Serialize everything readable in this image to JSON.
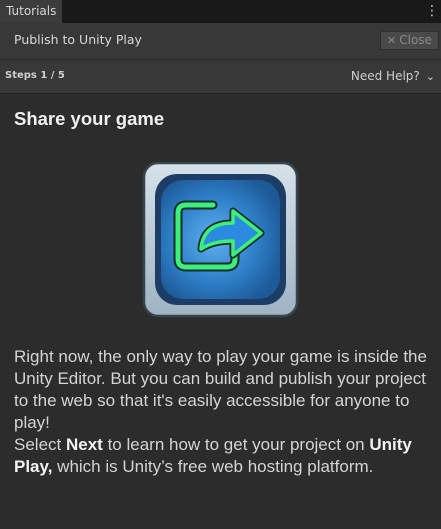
{
  "tab": {
    "label": "Tutorials"
  },
  "header": {
    "title": "Publish to Unity Play",
    "close_label": "Close"
  },
  "steps": {
    "label": "Steps 1 / 5",
    "help_label": "Need Help?"
  },
  "content": {
    "heading": "Share your game",
    "illustration_icon": "share-export-icon",
    "paragraph1": "Right now, the only way to play your game is inside the Unity Editor. But you can build and publish your project to the web so that it's easily accessible for anyone to play!",
    "p2_before": "Select ",
    "p2_bold1": "Next",
    "p2_mid": " to learn how to get your project on ",
    "p2_bold2": "Unity Play,",
    "p2_after": " which is Unity’s free web hosting platform."
  },
  "colors": {
    "background": "#383838",
    "content_bg": "#2c2c2c",
    "icon_green": "#3ef07a",
    "icon_blue": "#2f7fc8"
  }
}
